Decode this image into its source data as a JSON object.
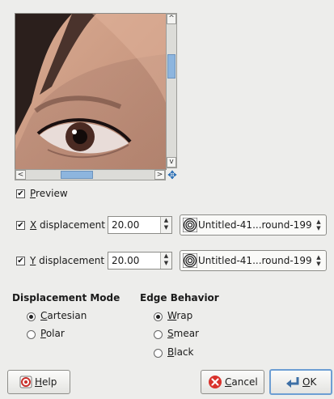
{
  "preview": {
    "scroll_up": "^",
    "scroll_down": "v",
    "scroll_left": "<",
    "scroll_right": ">",
    "nav_icon": "move-icon",
    "preview_label_pre": "",
    "preview_label_u": "P",
    "preview_label_post": "review",
    "preview_checked": true
  },
  "x_displacement": {
    "label_u": "X",
    "label_rest": " displacement",
    "checked": true,
    "value": "20.00",
    "map": "Untitled-41...round-199"
  },
  "y_displacement": {
    "label_u": "Y",
    "label_rest": " displacement",
    "checked": true,
    "value": "20.00",
    "map": "Untitled-41...round-199"
  },
  "displacement_mode": {
    "title": "Displacement Mode",
    "options": [
      {
        "u": "C",
        "rest": "artesian",
        "selected": true
      },
      {
        "u": "P",
        "rest": "olar",
        "selected": false
      }
    ]
  },
  "edge_behavior": {
    "title": "Edge Behavior",
    "options": [
      {
        "u": "W",
        "rest": "rap",
        "selected": true
      },
      {
        "u": "S",
        "rest": "mear",
        "selected": false
      },
      {
        "u": "B",
        "rest": "lack",
        "selected": false
      }
    ]
  },
  "buttons": {
    "help": {
      "u": "H",
      "rest": "elp"
    },
    "cancel": {
      "u": "C",
      "rest": "ancel"
    },
    "ok": {
      "u": "O",
      "rest": "K"
    }
  },
  "colors": {
    "accent": "#6d9ed3",
    "scroll_thumb": "#8db5de",
    "cancel_red": "#d9322c"
  }
}
